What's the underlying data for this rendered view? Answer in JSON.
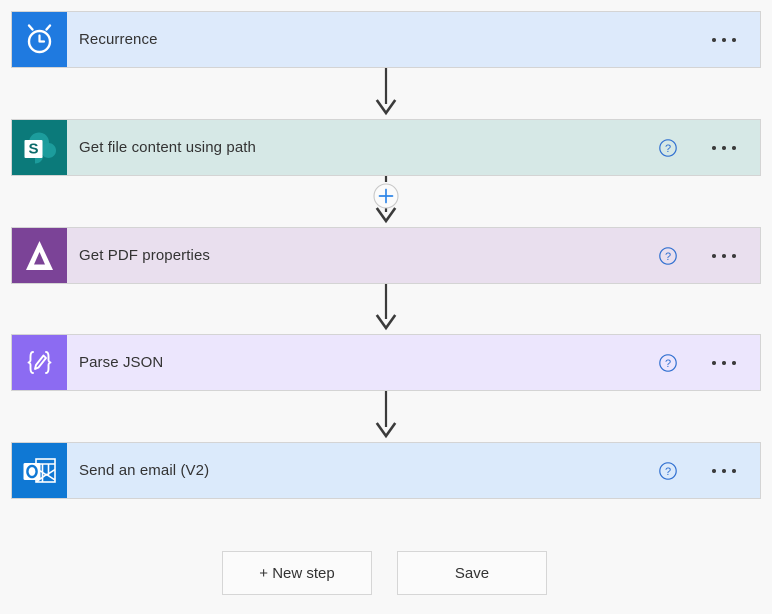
{
  "flow": {
    "steps": [
      {
        "id": "recurrence",
        "title": "Recurrence",
        "icon": "alarm-clock-icon",
        "icon_bg": "#1f7ae0",
        "card_bg": "#ddeafb",
        "has_help": false,
        "has_menu": true,
        "menu_label": "..."
      },
      {
        "id": "get-file-content-using-path",
        "title": "Get file content using path",
        "icon": "sharepoint-icon",
        "icon_bg": "#0b7a7a",
        "card_bg": "#d6e8e6",
        "has_help": true,
        "has_menu": true,
        "menu_label": "..."
      },
      {
        "id": "get-pdf-properties",
        "title": "Get PDF properties",
        "icon": "delta-triangle-icon",
        "icon_bg": "#7b4397",
        "card_bg": "#e9dfee",
        "has_help": true,
        "has_menu": true,
        "menu_label": "..."
      },
      {
        "id": "parse-json",
        "title": "Parse JSON",
        "icon": "parse-json-braces-icon",
        "icon_bg": "#8c6bf2",
        "card_bg": "#ece6fd",
        "has_help": true,
        "has_menu": true,
        "menu_label": "..."
      },
      {
        "id": "send-an-email-v2",
        "title": "Send an email (V2)",
        "icon": "outlook-icon",
        "icon_bg": "#0f78d4",
        "card_bg": "#dbeafb",
        "has_help": true,
        "has_menu": true,
        "menu_label": "..."
      }
    ],
    "connectors": [
      {
        "id": "connector-1",
        "type": "arrow"
      },
      {
        "id": "connector-2",
        "type": "arrow-with-insert",
        "insert_label": "+"
      },
      {
        "id": "connector-3",
        "type": "arrow"
      },
      {
        "id": "connector-4",
        "type": "arrow"
      }
    ]
  },
  "footer": {
    "new_step_label": "+ New step",
    "save_label": "Save"
  },
  "colors": {
    "canvas_bg": "#f8f8f8",
    "arrow": "#3b3b3b",
    "accent_blue": "#0f6cbd",
    "card_border": "#d4d4d4",
    "help_icon": "#2f6fd0"
  }
}
